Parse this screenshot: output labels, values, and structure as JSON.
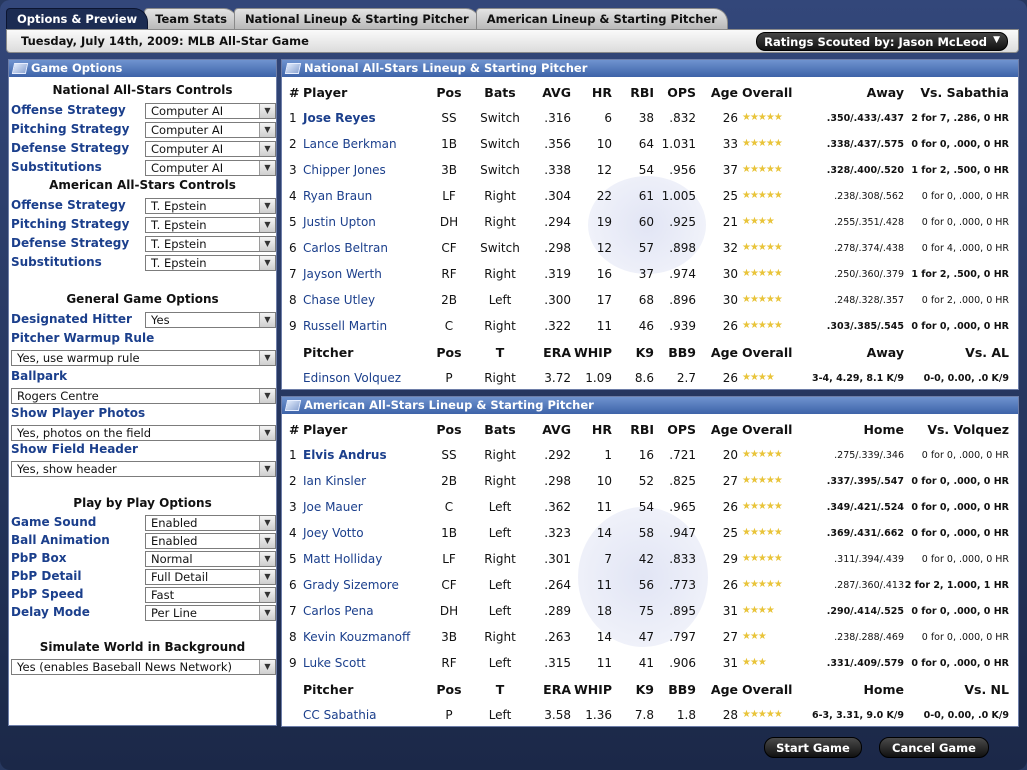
{
  "tabs": [
    {
      "label": "Options & Preview",
      "active": true
    },
    {
      "label": "Team Stats"
    },
    {
      "label": "National Lineup & Starting Pitcher"
    },
    {
      "label": "American Lineup & Starting Pitcher"
    }
  ],
  "header": {
    "date": "Tuesday, July 14th, 2009: MLB All-Star Game",
    "scout_button": "Ratings Scouted by: Jason McLeod",
    "scout_arrow": "▼"
  },
  "options": {
    "title": "Game Options",
    "national_head": "National All-Stars Controls",
    "american_head": "American All-Stars Controls",
    "general_head": "General Game Options",
    "pbp_head": "Play by Play Options",
    "sim_head": "Simulate World in Background",
    "national": [
      {
        "label": "Offense Strategy",
        "value": "Computer AI"
      },
      {
        "label": "Pitching Strategy",
        "value": "Computer AI"
      },
      {
        "label": "Defense Strategy",
        "value": "Computer AI"
      },
      {
        "label": "Substitutions",
        "value": "Computer AI"
      }
    ],
    "american": [
      {
        "label": "Offense Strategy",
        "value": "T. Epstein"
      },
      {
        "label": "Pitching Strategy",
        "value": "T. Epstein"
      },
      {
        "label": "Defense Strategy",
        "value": "T. Epstein"
      },
      {
        "label": "Substitutions",
        "value": "T. Epstein"
      }
    ],
    "dh": {
      "label": "Designated Hitter",
      "value": "Yes"
    },
    "warmup": {
      "label": "Pitcher Warmup Rule",
      "value": "Yes, use warmup rule"
    },
    "ballpark": {
      "label": "Ballpark",
      "value": "Rogers Centre"
    },
    "photos": {
      "label": "Show Player Photos",
      "value": "Yes, photos on the field"
    },
    "field_header": {
      "label": "Show Field Header",
      "value": "Yes, show header"
    },
    "pbp": [
      {
        "label": "Game Sound",
        "value": "Enabled"
      },
      {
        "label": "Ball Animation",
        "value": "Enabled"
      },
      {
        "label": "PbP Box",
        "value": "Normal"
      },
      {
        "label": "PbP Detail",
        "value": "Full Detail"
      },
      {
        "label": "PbP Speed",
        "value": "Fast"
      },
      {
        "label": "Delay Mode",
        "value": "Per Line"
      }
    ],
    "simulate": "Yes (enables Baseball News Network)"
  },
  "national": {
    "title": "National All-Stars Lineup & Starting Pitcher",
    "headers": [
      "#",
      "Player",
      "Pos",
      "Bats",
      "AVG",
      "HR",
      "RBI",
      "OPS",
      "Age",
      "Overall",
      "Away",
      "Vs. Sabathia"
    ],
    "players": [
      {
        "n": "1",
        "name": "Jose Reyes",
        "pos": "SS",
        "bats": "Switch",
        "avg": ".316",
        "hr": "6",
        "rbi": "38",
        "ops": ".832",
        "age": "26",
        "stars": "★★★★★",
        "split": ".350/.433/.437",
        "vs": "2 for 7, .286, 0 HR",
        "bold": true,
        "bsplit": true,
        "bvs": true
      },
      {
        "n": "2",
        "name": "Lance Berkman",
        "pos": "1B",
        "bats": "Switch",
        "avg": ".356",
        "hr": "10",
        "rbi": "64",
        "ops": "1.031",
        "age": "33",
        "stars": "★★★★★",
        "split": ".338/.437/.575",
        "vs": "0 for 0, .000, 0 HR",
        "bsplit": true,
        "bvs": true
      },
      {
        "n": "3",
        "name": "Chipper Jones",
        "pos": "3B",
        "bats": "Switch",
        "avg": ".338",
        "hr": "12",
        "rbi": "54",
        "ops": ".956",
        "age": "37",
        "stars": "★★★★★",
        "split": ".328/.400/.520",
        "vs": "1 for 2, .500, 0 HR",
        "bsplit": true,
        "bvs": true
      },
      {
        "n": "4",
        "name": "Ryan Braun",
        "pos": "LF",
        "bats": "Right",
        "avg": ".304",
        "hr": "22",
        "rbi": "61",
        "ops": "1.005",
        "age": "25",
        "stars": "★★★★★",
        "split": ".238/.308/.562",
        "vs": "0 for 0, .000, 0 HR"
      },
      {
        "n": "5",
        "name": "Justin Upton",
        "pos": "DH",
        "bats": "Right",
        "avg": ".294",
        "hr": "19",
        "rbi": "60",
        "ops": ".925",
        "age": "21",
        "stars": "★★★★",
        "split": ".255/.351/.428",
        "vs": "0 for 0, .000, 0 HR"
      },
      {
        "n": "6",
        "name": "Carlos Beltran",
        "pos": "CF",
        "bats": "Switch",
        "avg": ".298",
        "hr": "12",
        "rbi": "57",
        "ops": ".898",
        "age": "32",
        "stars": "★★★★★",
        "split": ".278/.374/.438",
        "vs": "0 for 4, .000, 0 HR"
      },
      {
        "n": "7",
        "name": "Jayson Werth",
        "pos": "RF",
        "bats": "Right",
        "avg": ".319",
        "hr": "16",
        "rbi": "37",
        "ops": ".974",
        "age": "30",
        "stars": "★★★★★",
        "split": ".250/.360/.379",
        "vs": "1 for 2, .500, 0 HR",
        "bvs": true
      },
      {
        "n": "8",
        "name": "Chase Utley",
        "pos": "2B",
        "bats": "Left",
        "avg": ".300",
        "hr": "17",
        "rbi": "68",
        "ops": ".896",
        "age": "30",
        "stars": "★★★★★",
        "split": ".248/.328/.357",
        "vs": "0 for 2, .000, 0 HR"
      },
      {
        "n": "9",
        "name": "Russell Martin",
        "pos": "C",
        "bats": "Right",
        "avg": ".322",
        "hr": "11",
        "rbi": "46",
        "ops": ".939",
        "age": "26",
        "stars": "★★★★★",
        "split": ".303/.385/.545",
        "vs": "0 for 0, .000, 0 HR",
        "bsplit": true,
        "bvs": true
      }
    ],
    "pitcher_headers": [
      "Pitcher",
      "Pos",
      "T",
      "ERA",
      "WHIP",
      "K9",
      "BB9",
      "Age",
      "Overall",
      "Away",
      "Vs. AL"
    ],
    "pitcher": {
      "name": "Edinson Volquez",
      "pos": "P",
      "t": "Right",
      "era": "3.72",
      "whip": "1.09",
      "k9": "8.6",
      "bb9": "2.7",
      "age": "26",
      "stars": "★★★★",
      "split": "3-4, 4.29, 8.1 K/9",
      "vs": "0-0, 0.00, .0 K/9"
    }
  },
  "american": {
    "title": "American All-Stars Lineup & Starting Pitcher",
    "headers": [
      "#",
      "Player",
      "Pos",
      "Bats",
      "AVG",
      "HR",
      "RBI",
      "OPS",
      "Age",
      "Overall",
      "Home",
      "Vs. Volquez"
    ],
    "players": [
      {
        "n": "1",
        "name": "Elvis Andrus",
        "pos": "SS",
        "bats": "Right",
        "avg": ".292",
        "hr": "1",
        "rbi": "16",
        "ops": ".721",
        "age": "20",
        "stars": "★★★★★",
        "split": ".275/.339/.346",
        "vs": "0 for 0, .000, 0 HR",
        "bold": true
      },
      {
        "n": "2",
        "name": "Ian Kinsler",
        "pos": "2B",
        "bats": "Right",
        "avg": ".298",
        "hr": "10",
        "rbi": "52",
        "ops": ".825",
        "age": "27",
        "stars": "★★★★★",
        "split": ".337/.395/.547",
        "vs": "0 for 0, .000, 0 HR",
        "bsplit": true,
        "bvs": true
      },
      {
        "n": "3",
        "name": "Joe Mauer",
        "pos": "C",
        "bats": "Left",
        "avg": ".362",
        "hr": "11",
        "rbi": "54",
        "ops": ".965",
        "age": "26",
        "stars": "★★★★★",
        "split": ".349/.421/.524",
        "vs": "0 for 0, .000, 0 HR",
        "bsplit": true,
        "bvs": true
      },
      {
        "n": "4",
        "name": "Joey Votto",
        "pos": "1B",
        "bats": "Left",
        "avg": ".323",
        "hr": "14",
        "rbi": "58",
        "ops": ".947",
        "age": "25",
        "stars": "★★★★★",
        "split": ".369/.431/.662",
        "vs": "0 for 0, .000, 0 HR",
        "bsplit": true,
        "bvs": true
      },
      {
        "n": "5",
        "name": "Matt Holliday",
        "pos": "LF",
        "bats": "Right",
        "avg": ".301",
        "hr": "7",
        "rbi": "42",
        "ops": ".833",
        "age": "29",
        "stars": "★★★★★",
        "split": ".311/.394/.439",
        "vs": "0 for 0, .000, 0 HR"
      },
      {
        "n": "6",
        "name": "Grady Sizemore",
        "pos": "CF",
        "bats": "Left",
        "avg": ".264",
        "hr": "11",
        "rbi": "56",
        "ops": ".773",
        "age": "26",
        "stars": "★★★★★",
        "split": ".287/.360/.413",
        "vs": "2 for 2, 1.000, 1 HR",
        "bvs": true
      },
      {
        "n": "7",
        "name": "Carlos Pena",
        "pos": "DH",
        "bats": "Left",
        "avg": ".289",
        "hr": "18",
        "rbi": "75",
        "ops": ".895",
        "age": "31",
        "stars": "★★★★",
        "split": ".290/.414/.525",
        "vs": "0 for 0, .000, 0 HR",
        "bsplit": true,
        "bvs": true
      },
      {
        "n": "8",
        "name": "Kevin Kouzmanoff",
        "pos": "3B",
        "bats": "Right",
        "avg": ".263",
        "hr": "14",
        "rbi": "47",
        "ops": ".797",
        "age": "27",
        "stars": "★★★",
        "split": ".238/.288/.469",
        "vs": "0 for 0, .000, 0 HR"
      },
      {
        "n": "9",
        "name": "Luke Scott",
        "pos": "RF",
        "bats": "Left",
        "avg": ".315",
        "hr": "11",
        "rbi": "41",
        "ops": ".906",
        "age": "31",
        "stars": "★★★",
        "split": ".331/.409/.579",
        "vs": "0 for 0, .000, 0 HR",
        "bsplit": true,
        "bvs": true
      }
    ],
    "pitcher_headers": [
      "Pitcher",
      "Pos",
      "T",
      "ERA",
      "WHIP",
      "K9",
      "BB9",
      "Age",
      "Overall",
      "Home",
      "Vs. NL"
    ],
    "pitcher": {
      "name": "CC Sabathia",
      "pos": "P",
      "t": "Left",
      "era": "3.58",
      "whip": "1.36",
      "k9": "7.8",
      "bb9": "1.8",
      "age": "28",
      "stars": "★★★★★",
      "split": "6-3, 3.31, 9.0 K/9",
      "vs": "0-0, 0.00, .0 K/9"
    }
  },
  "buttons": {
    "start": "Start Game",
    "cancel": "Cancel Game"
  },
  "dropdown_glyph": "▼"
}
